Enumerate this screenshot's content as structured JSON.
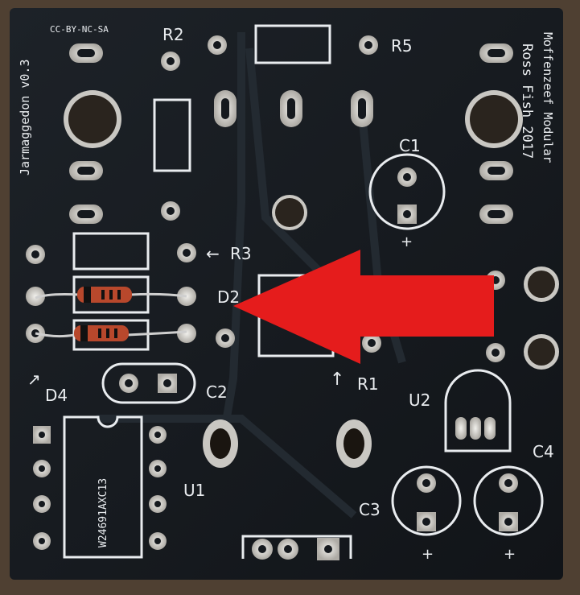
{
  "board": {
    "name": "Jarmaggedon v0.3",
    "license": "CC-BY-NC-SA",
    "credit_line1": "Ross Fish 2017",
    "credit_line2": "Moffenzeef Modular",
    "colors": {
      "background": "#5a4a3a",
      "board": "#15191e",
      "silkscreen": "#e9ecef",
      "pad": "#c9c7c2",
      "arrow": "#e51c1c"
    }
  },
  "labels": {
    "r1": "R1",
    "r2": "R2",
    "r3": "R3",
    "r5": "R5",
    "c1": "C1",
    "c2": "C2",
    "c3": "C3",
    "c4": "C4",
    "d2": "D2",
    "d4": "D4",
    "u1": "U1",
    "u2": "U2",
    "plus": "+",
    "chip_marking": "W24691AXC13"
  },
  "arrows": {
    "left": "←",
    "up": "↑",
    "diag": "↗"
  },
  "overlay": {
    "shape": "red-arrow-pointing-left",
    "target": "D2"
  }
}
